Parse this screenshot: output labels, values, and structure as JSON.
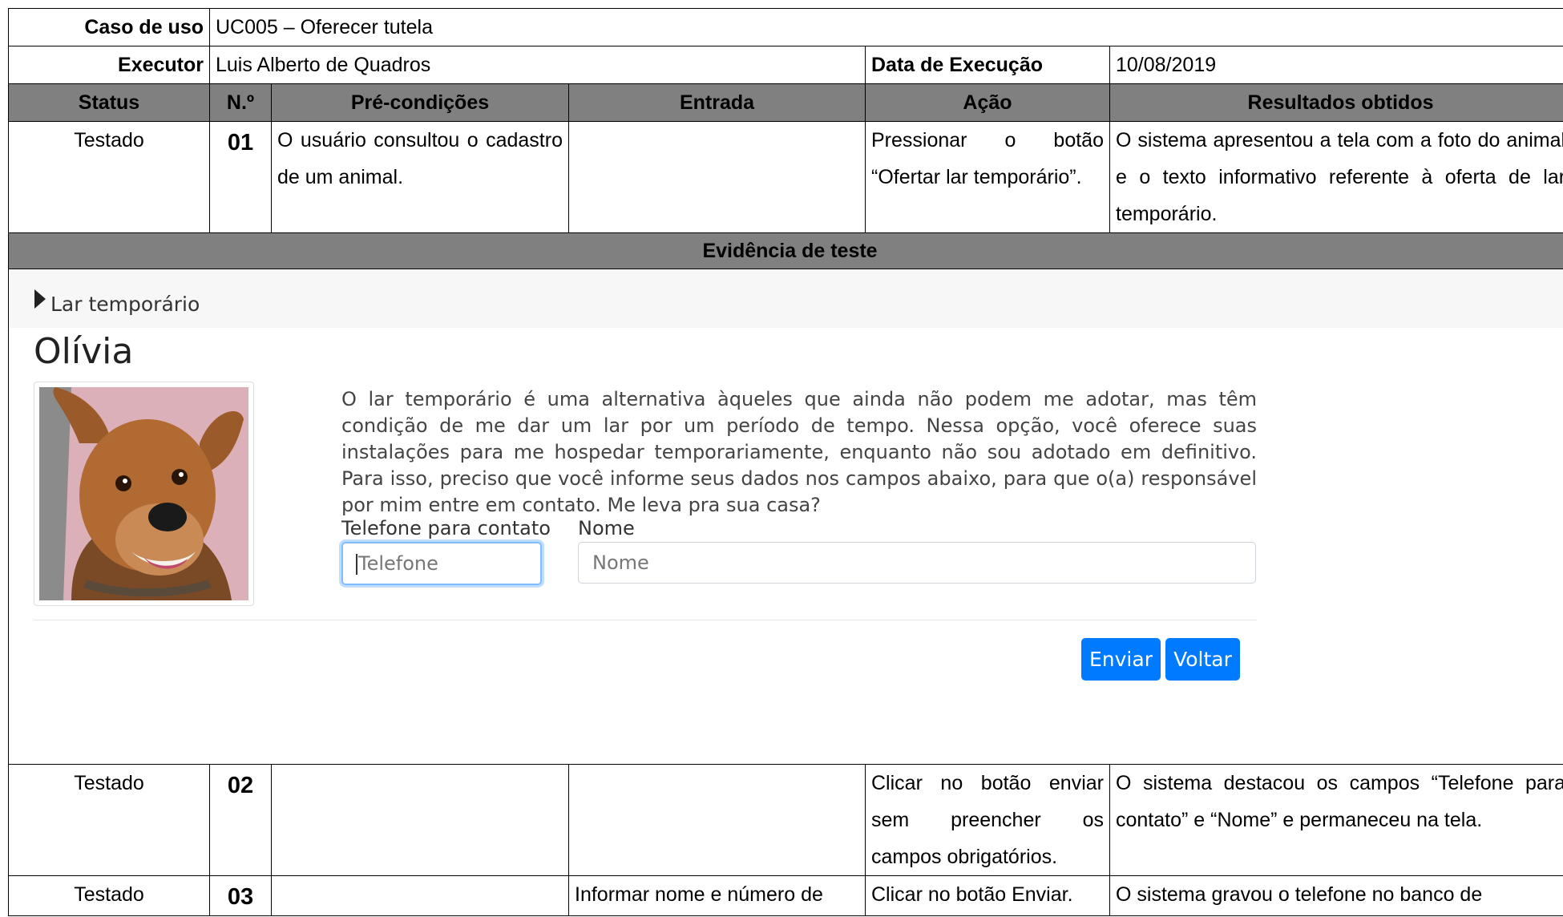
{
  "usecase": {
    "label": "Caso de uso",
    "value": "UC005 – Oferecer tutela"
  },
  "executor": {
    "label": "Executor",
    "value": "Luis Alberto de Quadros"
  },
  "exec_date": {
    "label": "Data de Execução",
    "value": "10/08/2019"
  },
  "headers": [
    "Status",
    "N.º",
    "Pré-condições",
    "Entrada",
    "Ação",
    "Resultados obtidos"
  ],
  "rows": [
    {
      "status": "Testado",
      "num": "01",
      "pre": "O usuário consultou o cadastro de um animal.",
      "input": "",
      "action": "Pressionar o botão “Ofertar lar temporário”.",
      "result": "O sistema apresentou a tela com a foto do animal e o texto informativo referente à oferta de lar temporário."
    },
    {
      "status": "Testado",
      "num": "02",
      "pre": "",
      "input": "",
      "action": "Clicar no botão enviar sem preencher os campos obrigatórios.",
      "result": "O sistema destacou os campos “Telefone para contato” e “Nome” e permaneceu na tela."
    },
    {
      "status": "Testado",
      "num": "03",
      "pre": "",
      "input": "Informar nome e número de",
      "action": "Clicar no botão Enviar.",
      "result": "O sistema gravou o telefone no banco de"
    }
  ],
  "evidence": {
    "title": "Evidência de teste",
    "breadcrumb": "Lar temporário",
    "animal_name": "Olívia",
    "description": "O lar temporário é uma alternativa àqueles que ainda não podem me adotar, mas têm condição de me dar um lar por um período de tempo. Nessa opção, você oferece suas instalações para me hospedar temporariamente, enquanto não sou adotado em definitivo. Para isso, preciso que você informe seus dados nos campos abaixo, para que o(a) responsável por mim entre em contato. Me leva pra sua casa?",
    "phone_label": "Telefone para contato",
    "phone_placeholder": "Telefone",
    "name_label": "Nome",
    "name_placeholder": "Nome",
    "send_button": "Enviar",
    "back_button": "Voltar",
    "accent_color": "#007bff"
  }
}
